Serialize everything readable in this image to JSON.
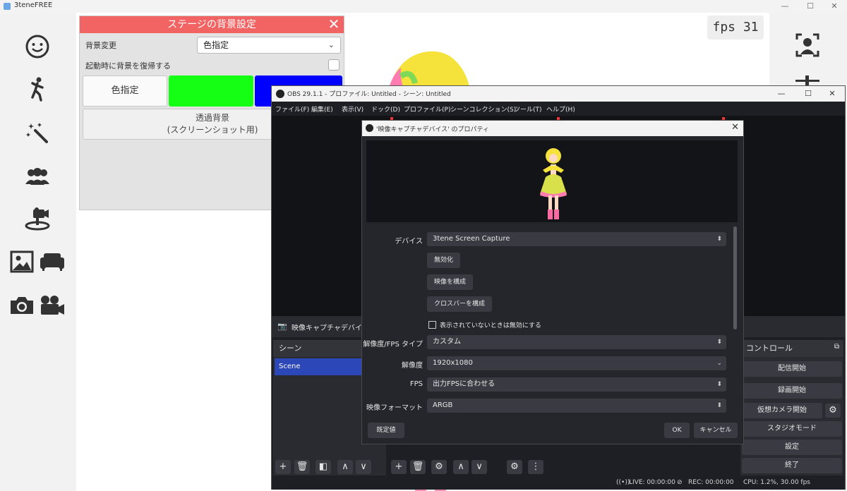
{
  "tene": {
    "title": "3teneFREE",
    "fps_label": "fps  31",
    "sidebar_icons": [
      "face-icon",
      "pose-icon",
      "effects-icon",
      "people-icon",
      "camera-stage-icon",
      "background-image-icon",
      "sofa-icon",
      "photo-camera-icon",
      "video-camera-icon"
    ],
    "right_icons": [
      "face-tracking-icon",
      "slider-icon"
    ]
  },
  "stage_panel": {
    "title": "ステージの背景設定",
    "bg_change_label": "背景変更",
    "bg_select_value": "色指定",
    "restore_label": "起動時に背景を復帰する",
    "custom_color_label": "色指定",
    "transparent_line1": "透過背景",
    "transparent_line2": "(スクリーンショット用)",
    "colors": {
      "green": "#14ff14",
      "blue": "#0000ff",
      "header": "#f26363"
    }
  },
  "obs": {
    "title": "OBS 29.1.1 - プロファイル: Untitled - シーン: Untitled",
    "menu": [
      "ファイル(F)",
      "編集(E)",
      "表示(V)",
      "ドック(D)",
      "プロファイル(P)",
      "シーンコレクション(S)",
      "ツール(T)",
      "ヘルプ(H)"
    ],
    "source_label": "映像キャプチャデバイス",
    "scenes_header": "シーン",
    "scene_item": "Scene",
    "controls_header": "コントロール",
    "controls": {
      "start_stream": "配信開始",
      "start_record": "録画開始",
      "virtual_cam": "仮想カメラ開始",
      "studio_mode": "スタジオモード",
      "settings": "設定",
      "exit": "終了"
    },
    "status": {
      "live": "LIVE: 00:00:00",
      "rec": "REC: 00:00:00",
      "cpu": "CPU: 1.2%, 30.00 fps"
    }
  },
  "props": {
    "title": "'映像キャプチャデバイス' のプロパティ",
    "device_label": "デバイス",
    "device_value": "3tene Screen Capture",
    "deactivate": "無効化",
    "configure_video": "映像を構成",
    "configure_crossbar": "クロスバーを構成",
    "deactivate_when_hidden": "表示されていないときは無効にする",
    "res_fps_type_label": "解像度/FPS タイプ",
    "res_fps_type_value": "カスタム",
    "resolution_label": "解像度",
    "resolution_value": "1920x1080",
    "fps_label": "FPS",
    "fps_value": "出力FPSに合わせる",
    "video_format_label": "映像フォーマット",
    "video_format_value": "ARGB",
    "defaults": "既定値",
    "ok": "OK",
    "cancel": "キャンセル"
  }
}
